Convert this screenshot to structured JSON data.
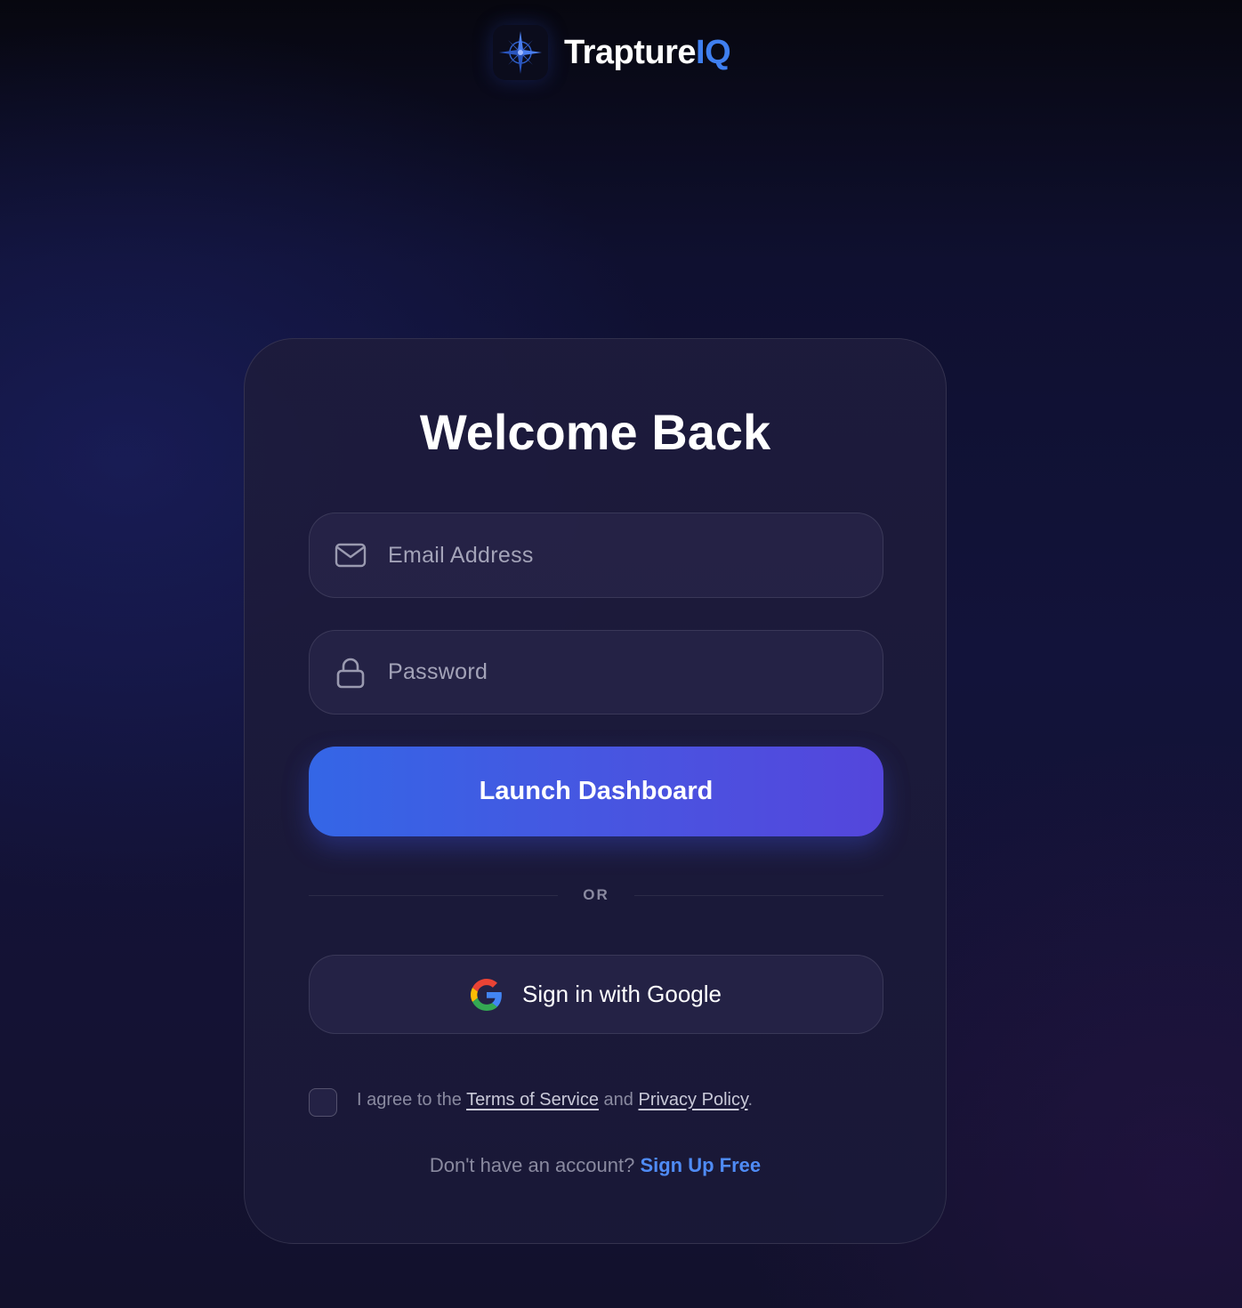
{
  "brand": {
    "name_main": "Trapture",
    "name_accent": "IQ",
    "logo_icon": "compass-star-icon",
    "accent_color": "#3f7ff0"
  },
  "card": {
    "title": "Welcome Back",
    "email_field": {
      "icon": "mail-icon",
      "placeholder": "Email Address",
      "value": ""
    },
    "password_field": {
      "icon": "lock-icon",
      "placeholder": "Password",
      "value": ""
    },
    "launch_button": {
      "label": "Launch Dashboard",
      "colors": [
        "#3466e6",
        "#5446dc"
      ]
    },
    "divider_label": "OR",
    "google_button": {
      "icon": "google-icon",
      "label": "Sign in with Google"
    },
    "terms": {
      "checked": false,
      "prefix": "I agree to the ",
      "terms_link": "Terms of Service",
      "middle": " and ",
      "privacy_link": "Privacy Policy",
      "suffix": "."
    },
    "signup": {
      "prompt": "Don't have an account? ",
      "link": "Sign Up Free",
      "link_color": "#4f8bf5"
    }
  }
}
